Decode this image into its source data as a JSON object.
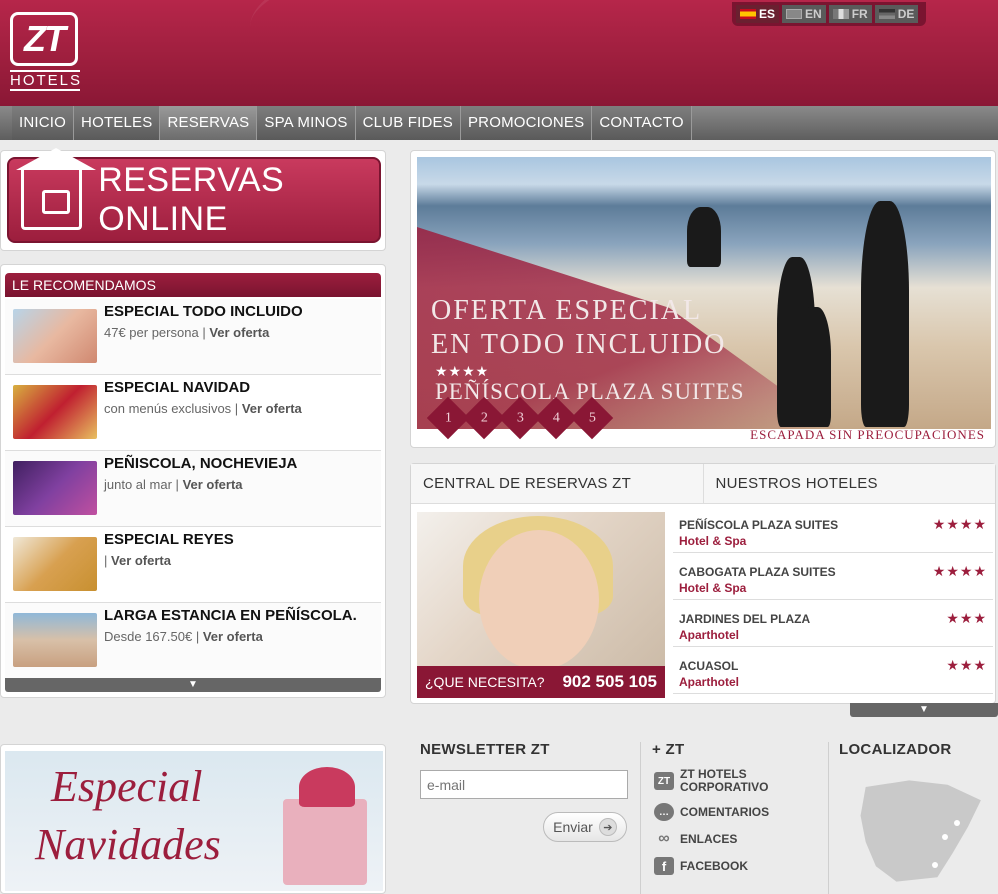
{
  "brand": {
    "logo_mark": "ZT",
    "logo_text": "HOTELS"
  },
  "languages": [
    {
      "code": "ES",
      "flag": "flag-es",
      "active": true
    },
    {
      "code": "EN",
      "flag": "flag-en",
      "active": false
    },
    {
      "code": "FR",
      "flag": "flag-fr",
      "active": false
    },
    {
      "code": "DE",
      "flag": "flag-de",
      "active": false
    }
  ],
  "nav": [
    "INICIO",
    "HOTELES",
    "RESERVAS",
    "SPA MINOS",
    "CLUB FIDES",
    "PROMOCIONES",
    "CONTACTO"
  ],
  "reservas": {
    "label": "RESERVAS ONLINE"
  },
  "recomendamos": {
    "header": "LE RECOMENDAMOS",
    "items": [
      {
        "title": "ESPECIAL TODO INCLUIDO",
        "sub": "47€ per persona",
        "link": "Ver oferta"
      },
      {
        "title": "ESPECIAL NAVIDAD",
        "sub": "con menús exclusivos",
        "link": "Ver oferta"
      },
      {
        "title": "PEÑISCOLA, NOCHEVIEJA",
        "sub": "junto al mar",
        "link": "Ver oferta"
      },
      {
        "title": "ESPECIAL REYES",
        "sub": "",
        "link": "Ver oferta"
      },
      {
        "title": "LARGA ESTANCIA EN PEÑÍSCOLA.",
        "sub": "Desde 167.50€",
        "link": "Ver oferta"
      }
    ],
    "separator": "|"
  },
  "hero": {
    "line1": "OFERTA ESPECIAL",
    "line2": "EN TODO INCLUIDO",
    "stars": "★★★★",
    "line3": "PEÑÍSCOLA PLAZA SUITES",
    "slides": [
      "1",
      "2",
      "3",
      "4",
      "5"
    ],
    "caption": "ESCAPADA SIN PREOCUPACIONES"
  },
  "central": {
    "tab1": "CENTRAL DE RESERVAS ZT",
    "tab2": "NUESTROS HOTELES",
    "question": "¿QUE NECESITA?",
    "phone": "902 505 105",
    "hotels": [
      {
        "name": "PEÑÍSCOLA PLAZA SUITES",
        "type": "Hotel & Spa",
        "stars": "★★★★"
      },
      {
        "name": "CABOGATA PLAZA SUITES",
        "type": "Hotel & Spa",
        "stars": "★★★★"
      },
      {
        "name": "JARDINES DEL PLAZA",
        "type": "Aparthotel",
        "stars": "★★★"
      },
      {
        "name": "ACUASOL",
        "type": "Aparthotel",
        "stars": "★★★"
      }
    ]
  },
  "navidad": {
    "line1": "Especial",
    "line2": "Navidades"
  },
  "newsletter": {
    "title": "NEWSLETTER ZT",
    "placeholder": "e-mail",
    "button": "Enviar"
  },
  "more": {
    "title": "+ ZT",
    "links": [
      {
        "icon": "zt-icon",
        "label": "ZT HOTELS CORPORATIVO",
        "glyph": "ZT"
      },
      {
        "icon": "comment-icon",
        "label": "COMENTARIOS",
        "glyph": "…"
      },
      {
        "icon": "link-icon",
        "label": "ENLACES",
        "glyph": "∞"
      },
      {
        "icon": "facebook-icon",
        "label": "FACEBOOK",
        "glyph": "f"
      }
    ]
  },
  "localizador": {
    "title": "LOCALIZADOR"
  },
  "colors": {
    "brand": "#9c1e3d",
    "nav": "#6a6a6a",
    "background": "#ebebeb"
  }
}
